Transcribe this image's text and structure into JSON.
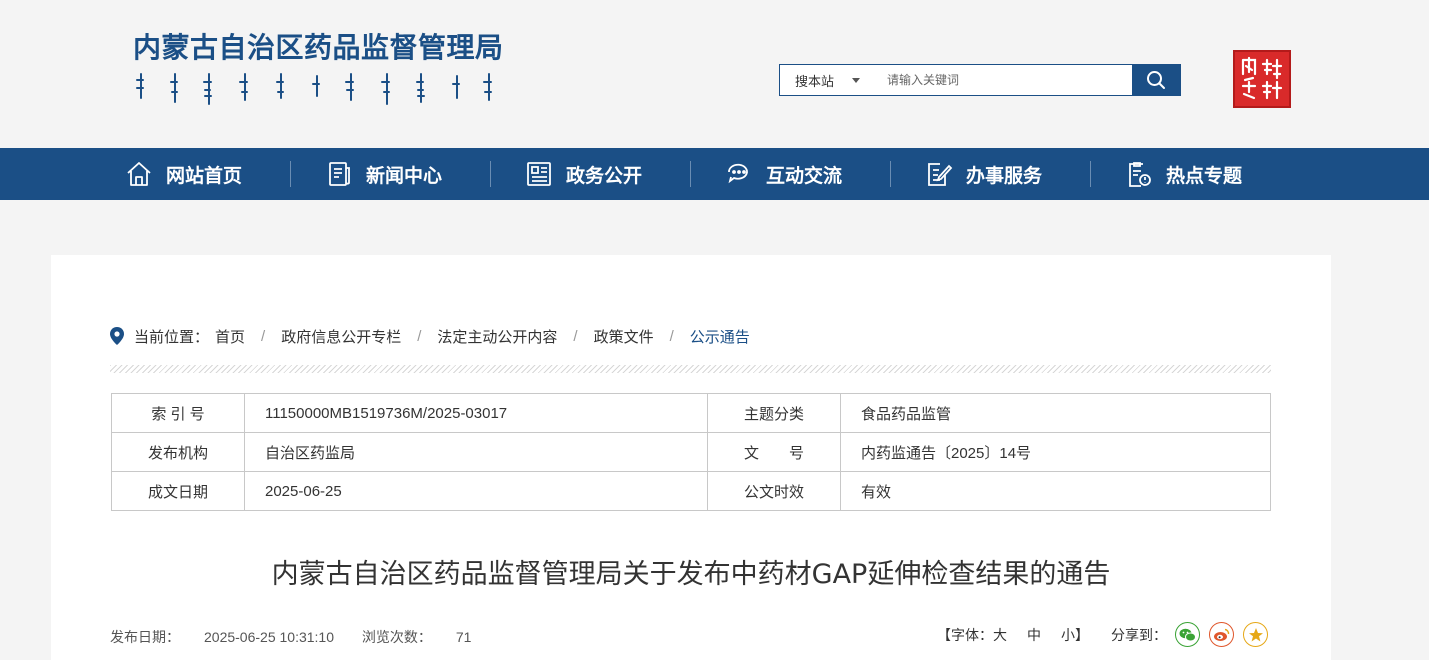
{
  "header": {
    "site_title": "内蒙古自治区药品监督管理局",
    "search": {
      "site_label": "搜本站",
      "placeholder": "请输入关键词"
    },
    "seal_icon": "seal-icon"
  },
  "nav": [
    {
      "label": "网站首页",
      "icon": "home-icon"
    },
    {
      "label": "新闻中心",
      "icon": "news-icon"
    },
    {
      "label": "政务公开",
      "icon": "document-list-icon"
    },
    {
      "label": "互动交流",
      "icon": "chat-icon"
    },
    {
      "label": "办事服务",
      "icon": "edit-icon"
    },
    {
      "label": "热点专题",
      "icon": "topic-icon"
    }
  ],
  "breadcrumb": {
    "prefix": "当前位置：",
    "items": [
      "首页",
      "政府信息公开专栏",
      "法定主动公开内容",
      "政策文件",
      "公示通告"
    ]
  },
  "meta_table": [
    {
      "label1": "索 引 号",
      "value1": "11150000MB1519736M/2025-03017",
      "label2": "主题分类",
      "value2": "食品药品监管"
    },
    {
      "label1": "发布机构",
      "value1": "自治区药监局",
      "label2": "文　　号",
      "value2": "内药监通告〔2025〕14号"
    },
    {
      "label1": "成文日期",
      "value1": "2025-06-25",
      "label2": "公文时效",
      "value2": "有效"
    }
  ],
  "article": {
    "title": "内蒙古自治区药品监督管理局关于发布中药材GAP延伸检查结果的通告",
    "publish_label": "发布日期：",
    "publish_date": "2025-06-25 10:31:10",
    "views_label": "浏览次数：",
    "views": "71"
  },
  "tools": {
    "font_prefix": "【字体：",
    "font_large": "大",
    "font_medium": "中",
    "font_small": "小",
    "font_suffix": "】",
    "share_label": "分享到："
  },
  "colors": {
    "primary": "#1b4f86",
    "seal": "#d92a2a",
    "wechat": "#3aa335",
    "weibo": "#e0572c",
    "favorite": "#e6a817"
  }
}
